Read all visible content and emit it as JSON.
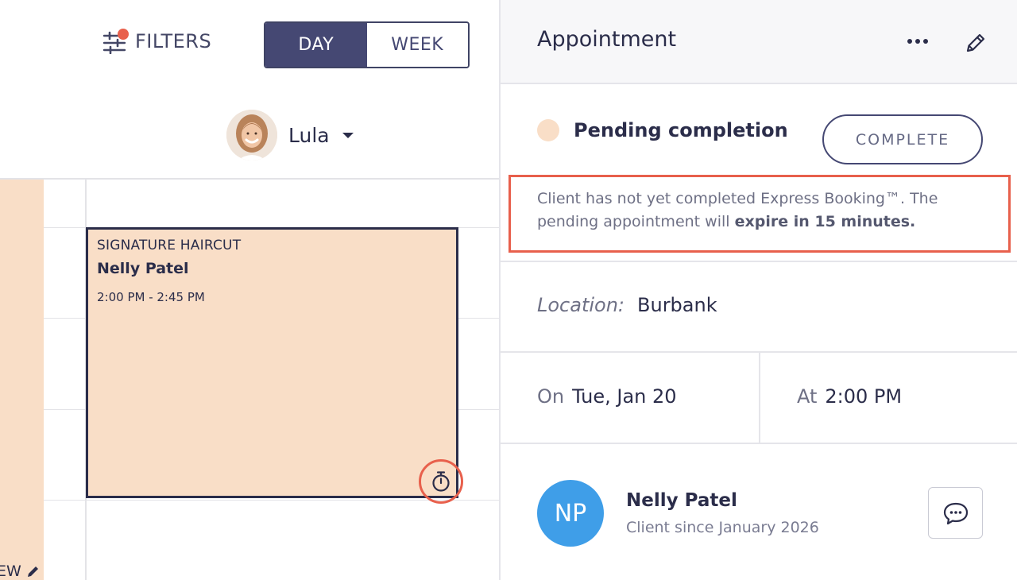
{
  "toolbar": {
    "filters_label": "FILTERS",
    "view_options": [
      "DAY",
      "WEEK"
    ],
    "selected_view": "DAY"
  },
  "staff": {
    "name": "Lula"
  },
  "calendar": {
    "left_block_text": "EW",
    "appointment": {
      "service": "SIGNATURE HAIRCUT",
      "client": "Nelly Patel",
      "time_range": "2:00 PM - 2:45 PM"
    }
  },
  "panel": {
    "title": "Appointment",
    "status": "Pending completion",
    "complete_label": "COMPLETE",
    "notice": {
      "text": "Client has not yet completed Express Booking™. The pending appointment will ",
      "bold": "expire in 15 minutes."
    },
    "location_label": "Location:",
    "location_value": "Burbank",
    "date_label": "On",
    "date_value": "Tue, Jan 20",
    "time_label": "At",
    "time_value": "2:00 PM",
    "client": {
      "initials": "NP",
      "name": "Nelly Patel",
      "since": "Client since January 2026"
    }
  },
  "colors": {
    "accent_navy": "#454873",
    "appointment_fill": "#f9dec7",
    "alert_red": "#e8604c",
    "client_avatar_blue": "#3f9ee8"
  },
  "icons": {
    "filters": "sliders-icon",
    "more": "more-horizontal-icon",
    "edit": "pencil-icon",
    "timer": "stopwatch-icon",
    "message": "chat-bubble-icon"
  }
}
